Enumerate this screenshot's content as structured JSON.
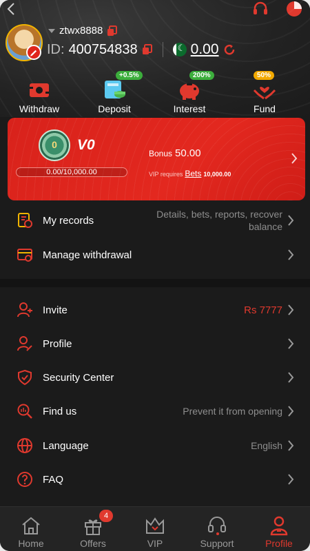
{
  "header": {
    "username": "ztwx8888",
    "id_label": "ID:",
    "id_value": "400754838",
    "balance": "0.00"
  },
  "quick_actions": [
    {
      "label": "Withdraw",
      "badge": ""
    },
    {
      "label": "Deposit",
      "badge": "+0.5%"
    },
    {
      "label": "Interest",
      "badge": "200%"
    },
    {
      "label": "Fund",
      "badge": "50%"
    }
  ],
  "vip": {
    "medal_text": "0",
    "level": "V0",
    "progress_text": "0.00/10,000.00",
    "progress_fraction": 0,
    "bonus_label": "Bonus",
    "bonus_value": "50.00",
    "requires_label": "VIP requires",
    "requires_link": "Bets",
    "requires_value": "10,000.00"
  },
  "section1": [
    {
      "title": "My records",
      "value": "Details, bets, reports, recover balance"
    },
    {
      "title": "Manage withdrawal",
      "value": ""
    }
  ],
  "section2": [
    {
      "title": "Invite",
      "value": "Rs 7777"
    },
    {
      "title": "Profile",
      "value": ""
    },
    {
      "title": "Security Center",
      "value": ""
    },
    {
      "title": "Find us",
      "value": "Prevent it from opening"
    },
    {
      "title": "Language",
      "value": "English"
    },
    {
      "title": "FAQ",
      "value": ""
    }
  ],
  "nav": {
    "items": [
      {
        "label": "Home"
      },
      {
        "label": "Offers",
        "badge": "4"
      },
      {
        "label": "VIP"
      },
      {
        "label": "Support"
      },
      {
        "label": "Profile"
      }
    ],
    "active": "Profile"
  },
  "colors": {
    "accent": "#e0392e",
    "card": "#e3281f",
    "background": "#1b1b1b",
    "nav_bg": "#242424"
  },
  "icons": {
    "back": "chevron-left-icon",
    "support": "headset-icon",
    "status": "pie-icon"
  }
}
